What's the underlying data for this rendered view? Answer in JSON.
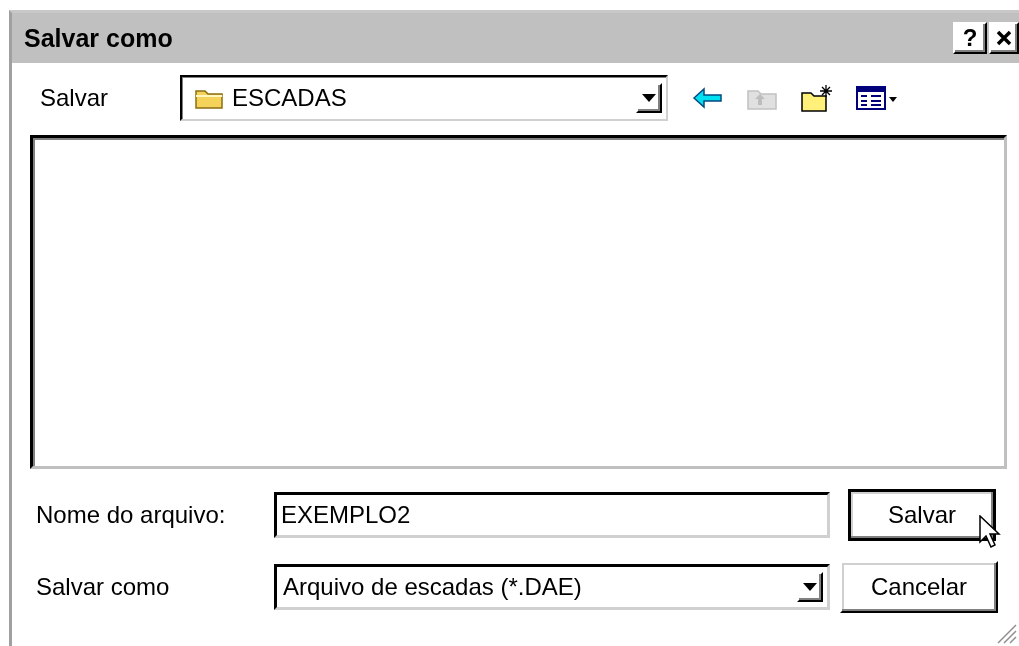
{
  "window": {
    "title": "Salvar como",
    "help_button": "?"
  },
  "save_in": {
    "label": "Salvar",
    "value": "ESCADAS"
  },
  "toolbar": [
    {
      "kind": "back",
      "disabled": false
    },
    {
      "kind": "up",
      "disabled": true
    },
    {
      "kind": "new-folder",
      "disabled": false
    },
    {
      "kind": "view-menu",
      "disabled": false
    }
  ],
  "file_name": {
    "label": "Nome do arquivo:",
    "value": "EXEMPLO2"
  },
  "file_type": {
    "label": "Salvar como",
    "value": "Arquivo de escadas (*.DAE)"
  },
  "buttons": [
    {
      "label": "Salvar",
      "default": true
    },
    {
      "label": "Cancelar",
      "default": false
    }
  ]
}
